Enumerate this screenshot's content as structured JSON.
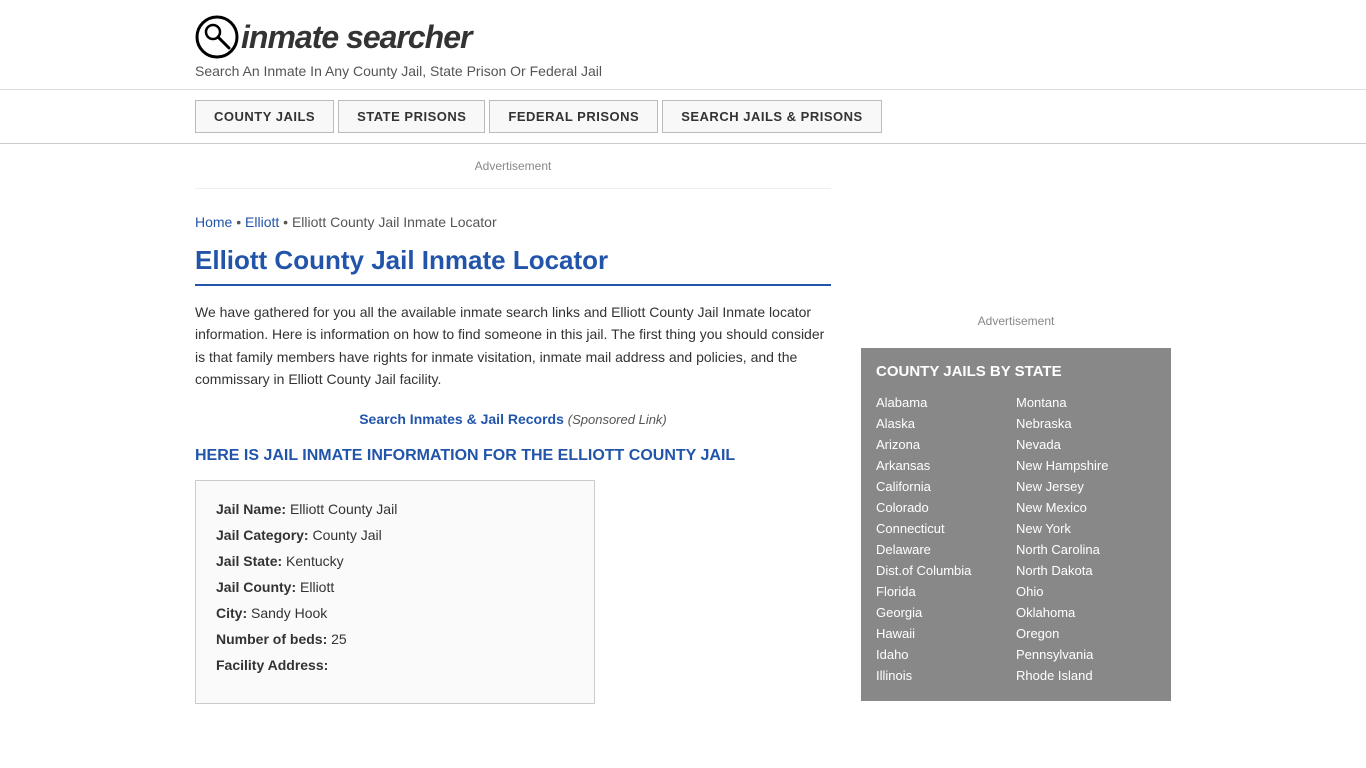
{
  "header": {
    "logo_text": "inmate searcher",
    "tagline": "Search An Inmate In Any County Jail, State Prison Or Federal Jail"
  },
  "nav": {
    "items": [
      {
        "label": "COUNTY JAILS",
        "id": "county-jails"
      },
      {
        "label": "STATE PRISONS",
        "id": "state-prisons"
      },
      {
        "label": "FEDERAL PRISONS",
        "id": "federal-prisons"
      },
      {
        "label": "SEARCH JAILS & PRISONS",
        "id": "search-jails"
      }
    ]
  },
  "breadcrumb": {
    "home": "Home",
    "separator1": " • ",
    "level2": "Elliott",
    "separator2": " • ",
    "current": "Elliott County Jail Inmate Locator"
  },
  "main": {
    "page_title": "Elliott County Jail Inmate Locator",
    "body_text": "We have gathered for you all the available inmate search links and Elliott County Jail Inmate locator information. Here is information on how to find someone in this jail. The first thing you should consider is that family members have rights for inmate visitation, inmate mail address and policies, and the commissary in Elliott County Jail facility.",
    "sponsored_link_text": "Search Inmates & Jail Records",
    "sponsored_note": "(Sponsored Link)",
    "section_heading": "HERE IS JAIL INMATE INFORMATION FOR THE ELLIOTT COUNTY JAIL",
    "info_rows": [
      {
        "label": "Jail Name:",
        "value": "Elliott County Jail"
      },
      {
        "label": "Jail Category:",
        "value": "County Jail"
      },
      {
        "label": "Jail State:",
        "value": "Kentucky"
      },
      {
        "label": "Jail County:",
        "value": "Elliott"
      },
      {
        "label": "City:",
        "value": "Sandy Hook"
      },
      {
        "label": "Number of beds:",
        "value": "25"
      },
      {
        "label": "Facility Address:",
        "value": ""
      }
    ]
  },
  "ad_label": "Advertisement",
  "sidebar": {
    "ad_label": "Advertisement",
    "county_jails_title": "COUNTY JAILS BY STATE",
    "states_col1": [
      "Alabama",
      "Alaska",
      "Arizona",
      "Arkansas",
      "California",
      "Colorado",
      "Connecticut",
      "Delaware",
      "Dist.of Columbia",
      "Florida",
      "Georgia",
      "Hawaii",
      "Idaho",
      "Illinois"
    ],
    "states_col2": [
      "Montana",
      "Nebraska",
      "Nevada",
      "New Hampshire",
      "New Jersey",
      "New Mexico",
      "New York",
      "North Carolina",
      "North Dakota",
      "Ohio",
      "Oklahoma",
      "Oregon",
      "Pennsylvania",
      "Rhode Island"
    ]
  }
}
